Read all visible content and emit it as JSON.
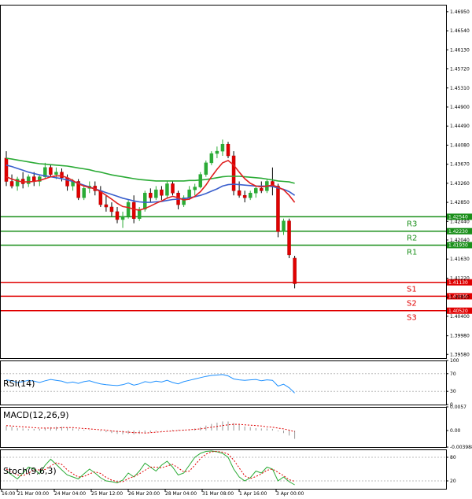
{
  "chart_data": [
    {
      "panel": "price",
      "type": "candlestick",
      "ylim": [
        1.395,
        1.471
      ],
      "y_ticks": [
        "1.46950",
        "1.46540",
        "1.46130",
        "1.45720",
        "1.45310",
        "1.44900",
        "1.44490",
        "1.44080",
        "1.43670",
        "1.43260",
        "1.42850",
        "1.42440",
        "1.42040",
        "1.41630",
        "1.41220",
        "1.40810",
        "1.40400",
        "1.39980",
        "1.39580"
      ],
      "x_ticks": [
        "16:00",
        "21 Mar 00:00",
        "24 Mar 04:00",
        "25 Mar 12:00",
        "26 Mar 20:00",
        "28 Mar 04:00",
        "31 Mar 08:00",
        "1 Apr 16:00",
        "3 Apr 00:00"
      ],
      "candles": [
        [
          1.438,
          1.4395,
          1.432,
          1.433
        ],
        [
          1.433,
          1.4345,
          1.4315,
          1.432
        ],
        [
          1.432,
          1.434,
          1.431,
          1.4335
        ],
        [
          1.4335,
          1.435,
          1.4315,
          1.4325
        ],
        [
          1.4325,
          1.4345,
          1.4318,
          1.434
        ],
        [
          1.434,
          1.435,
          1.432,
          1.433
        ],
        [
          1.433,
          1.4345,
          1.432,
          1.434
        ],
        [
          1.434,
          1.437,
          1.4335,
          1.436
        ],
        [
          1.436,
          1.4365,
          1.434,
          1.4345
        ],
        [
          1.4345,
          1.436,
          1.4335,
          1.435
        ],
        [
          1.435,
          1.4358,
          1.433,
          1.4338
        ],
        [
          1.4338,
          1.4345,
          1.431,
          1.432
        ],
        [
          1.432,
          1.4335,
          1.431,
          1.433
        ],
        [
          1.433,
          1.4335,
          1.429,
          1.4295
        ],
        [
          1.4295,
          1.432,
          1.429,
          1.4315
        ],
        [
          1.4315,
          1.433,
          1.4305,
          1.432
        ],
        [
          1.432,
          1.433,
          1.43,
          1.431
        ],
        [
          1.431,
          1.432,
          1.4275,
          1.428
        ],
        [
          1.428,
          1.43,
          1.4265,
          1.4275
        ],
        [
          1.4275,
          1.4285,
          1.4255,
          1.4265
        ],
        [
          1.4265,
          1.4275,
          1.424,
          1.4248
        ],
        [
          1.4248,
          1.4265,
          1.423,
          1.4255
        ],
        [
          1.4255,
          1.429,
          1.425,
          1.4285
        ],
        [
          1.4285,
          1.43,
          1.424,
          1.425
        ],
        [
          1.425,
          1.4275,
          1.4245,
          1.427
        ],
        [
          1.427,
          1.431,
          1.4265,
          1.4305
        ],
        [
          1.4305,
          1.4315,
          1.4285,
          1.4295
        ],
        [
          1.4295,
          1.432,
          1.429,
          1.4312
        ],
        [
          1.4312,
          1.432,
          1.429,
          1.43
        ],
        [
          1.43,
          1.433,
          1.4295,
          1.4325
        ],
        [
          1.4325,
          1.433,
          1.43,
          1.4305
        ],
        [
          1.4305,
          1.431,
          1.427,
          1.428
        ],
        [
          1.428,
          1.43,
          1.4275,
          1.4295
        ],
        [
          1.4295,
          1.432,
          1.429,
          1.4312
        ],
        [
          1.4312,
          1.4325,
          1.43,
          1.4318
        ],
        [
          1.4318,
          1.435,
          1.4315,
          1.4345
        ],
        [
          1.4345,
          1.4375,
          1.434,
          1.437
        ],
        [
          1.437,
          1.4395,
          1.4365,
          1.439
        ],
        [
          1.439,
          1.4405,
          1.438,
          1.4395
        ],
        [
          1.4395,
          1.442,
          1.4385,
          1.441
        ],
        [
          1.441,
          1.4415,
          1.438,
          1.4385
        ],
        [
          1.4385,
          1.4395,
          1.43,
          1.431
        ],
        [
          1.431,
          1.433,
          1.4295,
          1.43
        ],
        [
          1.43,
          1.431,
          1.4285,
          1.4295
        ],
        [
          1.4295,
          1.431,
          1.429,
          1.4305
        ],
        [
          1.4305,
          1.432,
          1.4295,
          1.4315
        ],
        [
          1.4315,
          1.433,
          1.4305,
          1.431
        ],
        [
          1.431,
          1.4335,
          1.4305,
          1.433
        ],
        [
          1.433,
          1.436,
          1.43,
          1.432
        ],
        [
          1.432,
          1.4325,
          1.421,
          1.4222
        ],
        [
          1.4222,
          1.425,
          1.4215,
          1.4245
        ],
        [
          1.4245,
          1.425,
          1.4165,
          1.4172
        ],
        [
          1.4165,
          1.417,
          1.41,
          1.411
        ]
      ],
      "moving_averages": [
        {
          "color": "#2bab36",
          "values": [
            1.438,
            1.4378,
            1.4376,
            1.4374,
            1.4372,
            1.437,
            1.4368,
            1.4367,
            1.4366,
            1.4365,
            1.4364,
            1.4363,
            1.4361,
            1.4359,
            1.4357,
            1.4355,
            1.4352,
            1.435,
            1.4347,
            1.4344,
            1.4342,
            1.434,
            1.4338,
            1.4336,
            1.4334,
            1.4333,
            1.4332,
            1.4331,
            1.4331,
            1.4331,
            1.4331,
            1.4331,
            1.4331,
            1.4332,
            1.4332,
            1.4333,
            1.4334,
            1.4336,
            1.4338,
            1.434,
            1.4341,
            1.4341,
            1.4341,
            1.434,
            1.4339,
            1.4338,
            1.4337,
            1.4335,
            1.4333,
            1.4331,
            1.433,
            1.4329,
            1.4326
          ]
        },
        {
          "color": "#3a5fcd",
          "values": [
            1.4365,
            1.4362,
            1.4358,
            1.4354,
            1.435,
            1.4347,
            1.4344,
            1.4342,
            1.434,
            1.4338,
            1.4336,
            1.4333,
            1.433,
            1.4326,
            1.4322,
            1.4318,
            1.4314,
            1.431,
            1.4306,
            1.4302,
            1.4298,
            1.4294,
            1.4291,
            1.4288,
            1.4286,
            1.4285,
            1.4285,
            1.4286,
            1.4287,
            1.4289,
            1.4291,
            1.4292,
            1.4293,
            1.4295,
            1.4297,
            1.43,
            1.4304,
            1.4309,
            1.4314,
            1.432,
            1.4323,
            1.4324,
            1.4323,
            1.4322,
            1.4321,
            1.432,
            1.432,
            1.432,
            1.4319,
            1.4316,
            1.4313,
            1.4308,
            1.43
          ]
        },
        {
          "color": "#e02020",
          "values": [
            1.434,
            1.4335,
            1.4331,
            1.4329,
            1.4329,
            1.433,
            1.4332,
            1.4336,
            1.434,
            1.4342,
            1.4342,
            1.4338,
            1.4332,
            1.4325,
            1.432,
            1.4317,
            1.4314,
            1.4308,
            1.43,
            1.4292,
            1.4283,
            1.4276,
            1.4274,
            1.427,
            1.4268,
            1.4272,
            1.4277,
            1.4283,
            1.4288,
            1.4294,
            1.4298,
            1.4295,
            1.429,
            1.4292,
            1.4298,
            1.4308,
            1.4322,
            1.434,
            1.4356,
            1.437,
            1.4375,
            1.4365,
            1.435,
            1.4336,
            1.4326,
            1.432,
            1.4318,
            1.432,
            1.4322,
            1.4318,
            1.4312,
            1.43,
            1.4285
          ]
        }
      ],
      "levels": [
        {
          "name": "R3",
          "value": 1.4254,
          "label": "1.42540",
          "color": "#1a8f1a"
        },
        {
          "name": "R2",
          "value": 1.4223,
          "label": "1.42230",
          "color": "#1a8f1a"
        },
        {
          "name": "R1",
          "value": 1.4193,
          "label": "1.41930",
          "color": "#1a8f1a"
        },
        {
          "name": "S1",
          "value": 1.4113,
          "label": "1.41130",
          "color": "#e00000"
        },
        {
          "name": "S2",
          "value": 1.4083,
          "label": "1.40830",
          "color": "#e00000"
        },
        {
          "name": "S3",
          "value": 1.4052,
          "label": "1.40520",
          "color": "#e00000"
        }
      ]
    },
    {
      "panel": "rsi",
      "type": "line",
      "title": "RSI(14)",
      "ylim": [
        0,
        100
      ],
      "y_ticks": [
        "100",
        "70",
        "30",
        "0"
      ],
      "values": [
        56,
        54,
        50,
        52,
        55,
        53,
        50,
        54,
        57,
        55,
        53,
        49,
        51,
        48,
        52,
        54,
        50,
        47,
        45,
        44,
        43,
        45,
        49,
        44,
        47,
        52,
        50,
        53,
        51,
        55,
        50,
        47,
        52,
        55,
        58,
        61,
        64,
        66,
        67,
        68,
        65,
        58,
        56,
        55,
        56,
        57,
        54,
        56,
        55,
        42,
        46,
        38,
        26
      ]
    },
    {
      "panel": "macd",
      "type": "bar",
      "title": "MACD(12,26,9)",
      "ylim": [
        -0.00398,
        0.0057
      ],
      "y_ticks": [
        "0.0057",
        "0.00",
        "-0.003988"
      ],
      "histogram": [
        0.0011,
        0.0009,
        0.0006,
        0.0005,
        0.0004,
        0.0004,
        0.0004,
        0.0006,
        0.0008,
        0.0009,
        0.0009,
        0.0007,
        0.0005,
        0.0003,
        0.0002,
        0.0001,
        0.0,
        -0.0002,
        -0.0004,
        -0.0006,
        -0.0008,
        -0.0009,
        -0.0008,
        -0.0009,
        -0.0008,
        -0.0006,
        -0.0004,
        -0.0002,
        -0.0001,
        0.0001,
        0.0002,
        0.0002,
        0.0002,
        0.0003,
        0.0005,
        0.0008,
        0.0012,
        0.0016,
        0.0019,
        0.0022,
        0.0022,
        0.0018,
        0.0014,
        0.001,
        0.0008,
        0.0006,
        0.0005,
        0.0005,
        0.0004,
        -0.0002,
        -0.0006,
        -0.0012,
        -0.002
      ],
      "signal": [
        0.0012,
        0.0011,
        0.001,
        0.0009,
        0.0008,
        0.0007,
        0.0006,
        0.0006,
        0.0006,
        0.0006,
        0.0007,
        0.0007,
        0.0007,
        0.0006,
        0.0005,
        0.0004,
        0.0003,
        0.0002,
        0.0001,
        -0.0001,
        -0.0002,
        -0.0003,
        -0.0004,
        -0.0005,
        -0.0005,
        -0.0006,
        -0.0005,
        -0.0004,
        -0.0003,
        -0.0002,
        -0.0001,
        0.0,
        0.0001,
        0.0002,
        0.0003,
        0.0004,
        0.0006,
        0.0008,
        0.001,
        0.0012,
        0.0014,
        0.0015,
        0.0015,
        0.0014,
        0.0013,
        0.0012,
        0.0011,
        0.0009,
        0.0008,
        0.0006,
        0.0004,
        0.0001,
        -0.0003
      ]
    },
    {
      "panel": "stoch",
      "type": "line",
      "title": "Stoch(9,6,3)",
      "ylim": [
        0,
        100
      ],
      "y_ticks": [
        "80",
        "20"
      ],
      "main": [
        45,
        35,
        25,
        40,
        55,
        50,
        38,
        60,
        75,
        62,
        48,
        35,
        30,
        25,
        38,
        50,
        40,
        28,
        20,
        18,
        15,
        22,
        40,
        30,
        45,
        65,
        55,
        45,
        60,
        70,
        55,
        35,
        40,
        60,
        80,
        90,
        95,
        96,
        94,
        90,
        80,
        50,
        30,
        20,
        28,
        45,
        40,
        55,
        50,
        20,
        30,
        18,
        10
      ],
      "signal": [
        50,
        43,
        35,
        33,
        40,
        48,
        48,
        49,
        58,
        66,
        62,
        48,
        38,
        30,
        31,
        38,
        43,
        39,
        29,
        22,
        18,
        18,
        26,
        31,
        38,
        47,
        55,
        55,
        53,
        58,
        62,
        53,
        43,
        45,
        60,
        77,
        88,
        94,
        95,
        93,
        88,
        73,
        53,
        33,
        26,
        31,
        38,
        47,
        50,
        42,
        33,
        23,
        19
      ]
    }
  ]
}
